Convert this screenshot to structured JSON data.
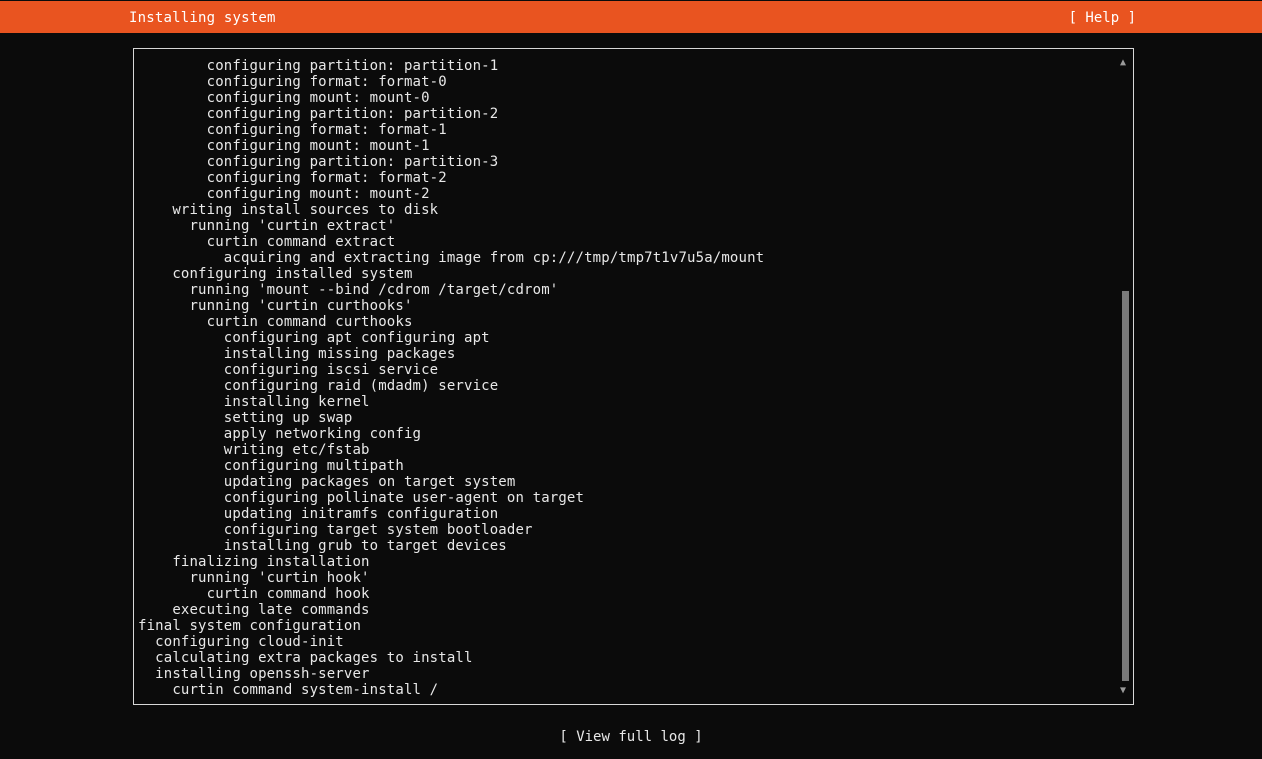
{
  "header": {
    "title": "Installing system",
    "help_label": "[ Help ]",
    "color": "#e95420"
  },
  "log": {
    "lines": [
      "        configuring partition: partition-1",
      "        configuring format: format-0",
      "        configuring mount: mount-0",
      "        configuring partition: partition-2",
      "        configuring format: format-1",
      "        configuring mount: mount-1",
      "        configuring partition: partition-3",
      "        configuring format: format-2",
      "        configuring mount: mount-2",
      "    writing install sources to disk",
      "      running 'curtin extract'",
      "        curtin command extract",
      "          acquiring and extracting image from cp:///tmp/tmp7t1v7u5a/mount",
      "    configuring installed system",
      "      running 'mount --bind /cdrom /target/cdrom'",
      "      running 'curtin curthooks'",
      "        curtin command curthooks",
      "          configuring apt configuring apt",
      "          installing missing packages",
      "          configuring iscsi service",
      "          configuring raid (mdadm) service",
      "          installing kernel",
      "          setting up swap",
      "          apply networking config",
      "          writing etc/fstab",
      "          configuring multipath",
      "          updating packages on target system",
      "          configuring pollinate user-agent on target",
      "          updating initramfs configuration",
      "          configuring target system bootloader",
      "          installing grub to target devices",
      "    finalizing installation",
      "      running 'curtin hook'",
      "        curtin command hook",
      "    executing late commands",
      "final system configuration",
      "  configuring cloud-init",
      "  calculating extra packages to install",
      "  installing openssh-server",
      "    curtin command system-install /"
    ],
    "scroll": {
      "thumb_start": 0.36,
      "thumb_end": 1.0
    }
  },
  "footer": {
    "view_log_label": "[ View full log ]"
  }
}
